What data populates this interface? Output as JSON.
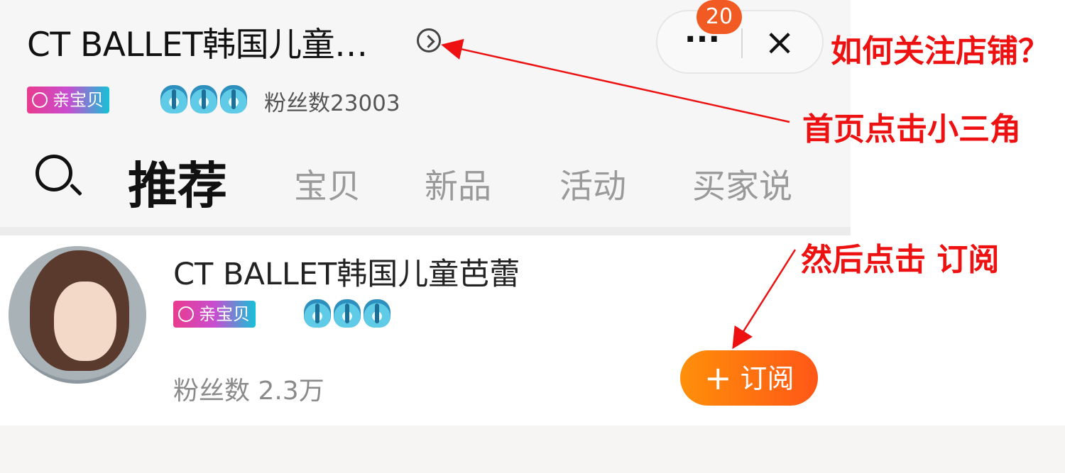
{
  "header": {
    "store_title": "CT BALLET韩国儿童…",
    "badge_count": "20",
    "more_label": "···",
    "close_label": "×",
    "brand_badge": "亲宝贝",
    "fans_text": "粉丝数23003"
  },
  "tabs": [
    {
      "label": "推荐",
      "active": true
    },
    {
      "label": "宝贝"
    },
    {
      "label": "新品"
    },
    {
      "label": "活动"
    },
    {
      "label": "买家说"
    }
  ],
  "shop_card": {
    "name": "CT BALLET韩国儿童芭蕾",
    "brand_badge": "亲宝贝",
    "fans_text": "粉丝数 2.3万",
    "subscribe_label": "订阅",
    "subscribe_icon": "plus-icon"
  },
  "annotations": {
    "question": "如何关注店铺？",
    "step1": "首页点击小三角",
    "step2": "然后点击 订阅",
    "color": "#ee1111"
  },
  "colors": {
    "accent_orange": "#ff6a00",
    "badge_red": "#f15a22"
  }
}
